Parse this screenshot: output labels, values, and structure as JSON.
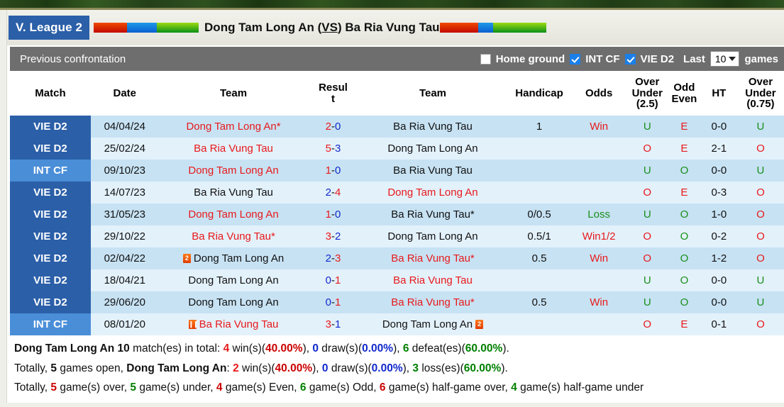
{
  "header": {
    "league_badge": "V. League 2",
    "match_title_home": "Dong Tam Long An",
    "match_title_vs": "VS",
    "match_title_away": "Ba Ria Vung Tau",
    "title_open_paren": " (",
    "title_close_paren": ") ",
    "accent_badge_color": "#2b5fa8"
  },
  "controls": {
    "section_title": "Previous confrontation",
    "home_ground_label": "Home ground",
    "home_ground_checked": false,
    "int_cf_label": "INT CF",
    "int_cf_checked": true,
    "vie_d2_label": "VIE D2",
    "vie_d2_checked": true,
    "last_label": "Last",
    "last_value": "10",
    "games_label": "games"
  },
  "table": {
    "columns": [
      "Match",
      "Date",
      "Team",
      "Result",
      "Team",
      "Handicap",
      "Odds",
      "Over Under (2.5)",
      "Odd Even",
      "HT",
      "Over Under (0.75)"
    ],
    "headers": {
      "match": "Match",
      "date": "Date",
      "team_home": "Team",
      "result_l1": "Resul",
      "result_l2": "t",
      "team_away": "Team",
      "handicap": "Handicap",
      "odds": "Odds",
      "ou25_l1": "Over",
      "ou25_l2": "Under",
      "ou25_l3": "(2.5)",
      "oe_l1": "Odd",
      "oe_l2": "Even",
      "ht": "HT",
      "ou075_l1": "Over",
      "ou075_l2": "Under",
      "ou075_l3": "(0.75)"
    },
    "rows": [
      {
        "match": "VIE D2",
        "match_type": "vie",
        "date": "04/04/24",
        "home": "Dong Tam Long An*",
        "home_color": "red",
        "home_icon": "",
        "score_home": "2",
        "score_home_color": "red",
        "score_away": "0",
        "score_away_color": "blue",
        "away": "Ba Ria Vung Tau",
        "away_color": "black",
        "away_icon": "",
        "handicap": "1",
        "odds": "Win",
        "odds_color": "red",
        "ou25": "U",
        "ou25_color": "green",
        "oe": "E",
        "oe_color": "red",
        "ht": "0-0",
        "ou075": "U",
        "ou075_color": "green"
      },
      {
        "match": "VIE D2",
        "match_type": "vie",
        "date": "25/02/24",
        "home": "Ba Ria Vung Tau",
        "home_color": "red",
        "home_icon": "",
        "score_home": "5",
        "score_home_color": "red",
        "score_away": "3",
        "score_away_color": "blue",
        "away": "Dong Tam Long An",
        "away_color": "black",
        "away_icon": "",
        "handicap": "",
        "odds": "",
        "odds_color": "black",
        "ou25": "O",
        "ou25_color": "red",
        "oe": "E",
        "oe_color": "red",
        "ht": "2-1",
        "ou075": "O",
        "ou075_color": "red"
      },
      {
        "match": "INT CF",
        "match_type": "int",
        "date": "09/10/23",
        "home": "Dong Tam Long An",
        "home_color": "red",
        "home_icon": "",
        "score_home": "1",
        "score_home_color": "red",
        "score_away": "0",
        "score_away_color": "blue",
        "away": "Ba Ria Vung Tau",
        "away_color": "black",
        "away_icon": "",
        "handicap": "",
        "odds": "",
        "odds_color": "black",
        "ou25": "U",
        "ou25_color": "green",
        "oe": "O",
        "oe_color": "green",
        "ht": "0-0",
        "ou075": "U",
        "ou075_color": "green"
      },
      {
        "match": "VIE D2",
        "match_type": "vie",
        "date": "14/07/23",
        "home": "Ba Ria Vung Tau",
        "home_color": "black",
        "home_icon": "",
        "score_home": "2",
        "score_home_color": "blue",
        "score_away": "4",
        "score_away_color": "red",
        "away": "Dong Tam Long An",
        "away_color": "red",
        "away_icon": "",
        "handicap": "",
        "odds": "",
        "odds_color": "black",
        "ou25": "O",
        "ou25_color": "red",
        "oe": "E",
        "oe_color": "red",
        "ht": "0-3",
        "ou075": "O",
        "ou075_color": "red"
      },
      {
        "match": "VIE D2",
        "match_type": "vie",
        "date": "31/05/23",
        "home": "Dong Tam Long An",
        "home_color": "red",
        "home_icon": "",
        "score_home": "1",
        "score_home_color": "red",
        "score_away": "0",
        "score_away_color": "blue",
        "away": "Ba Ria Vung Tau*",
        "away_color": "black",
        "away_icon": "",
        "handicap": "0/0.5",
        "odds": "Loss",
        "odds_color": "green",
        "ou25": "U",
        "ou25_color": "green",
        "oe": "O",
        "oe_color": "green",
        "ht": "1-0",
        "ou075": "O",
        "ou075_color": "red"
      },
      {
        "match": "VIE D2",
        "match_type": "vie",
        "date": "29/10/22",
        "home": "Ba Ria Vung Tau*",
        "home_color": "red",
        "home_icon": "",
        "score_home": "3",
        "score_home_color": "red",
        "score_away": "2",
        "score_away_color": "blue",
        "away": "Dong Tam Long An",
        "away_color": "black",
        "away_icon": "",
        "handicap": "0.5/1",
        "odds": "Win1/2",
        "odds_color": "red",
        "ou25": "O",
        "ou25_color": "red",
        "oe": "O",
        "oe_color": "green",
        "ht": "0-2",
        "ou075": "O",
        "ou075_color": "red"
      },
      {
        "match": "VIE D2",
        "match_type": "vie",
        "date": "02/04/22",
        "home": "Dong Tam Long An",
        "home_color": "black",
        "home_icon": "red-card-icon",
        "score_home": "2",
        "score_home_color": "blue",
        "score_away": "3",
        "score_away_color": "red",
        "away": "Ba Ria Vung Tau*",
        "away_color": "red",
        "away_icon": "",
        "handicap": "0.5",
        "odds": "Win",
        "odds_color": "red",
        "ou25": "O",
        "ou25_color": "red",
        "oe": "O",
        "oe_color": "green",
        "ht": "1-2",
        "ou075": "O",
        "ou075_color": "red"
      },
      {
        "match": "VIE D2",
        "match_type": "vie",
        "date": "18/04/21",
        "home": "Dong Tam Long An",
        "home_color": "black",
        "home_icon": "",
        "score_home": "0",
        "score_home_color": "blue",
        "score_away": "1",
        "score_away_color": "red",
        "away": "Ba Ria Vung Tau",
        "away_color": "red",
        "away_icon": "",
        "handicap": "",
        "odds": "",
        "odds_color": "black",
        "ou25": "U",
        "ou25_color": "green",
        "oe": "O",
        "oe_color": "green",
        "ht": "0-0",
        "ou075": "U",
        "ou075_color": "green"
      },
      {
        "match": "VIE D2",
        "match_type": "vie",
        "date": "29/06/20",
        "home": "Dong Tam Long An",
        "home_color": "black",
        "home_icon": "",
        "score_home": "0",
        "score_home_color": "blue",
        "score_away": "1",
        "score_away_color": "red",
        "away": "Ba Ria Vung Tau*",
        "away_color": "red",
        "away_icon": "",
        "handicap": "0.5",
        "odds": "Win",
        "odds_color": "red",
        "ou25": "U",
        "ou25_color": "green",
        "oe": "O",
        "oe_color": "green",
        "ht": "0-0",
        "ou075": "U",
        "ou075_color": "green"
      },
      {
        "match": "INT CF",
        "match_type": "int",
        "date": "08/01/20",
        "home": "Ba Ria Vung Tau",
        "home_color": "red",
        "home_icon": "double-yellow-card-icon",
        "score_home": "3",
        "score_home_color": "red",
        "score_away": "1",
        "score_away_color": "blue",
        "away": "Dong Tam Long An",
        "away_color": "black",
        "away_icon": "red-card-icon",
        "handicap": "",
        "odds": "",
        "odds_color": "black",
        "ou25": "O",
        "ou25_color": "red",
        "oe": "E",
        "oe_color": "red",
        "ht": "0-1",
        "ou075": "O",
        "ou075_color": "red"
      }
    ]
  },
  "summary": {
    "line1": {
      "team": "Dong Tam Long An",
      "total_count": "10",
      "total_text": " match(es) in total: ",
      "wins": "4",
      "wins_text": " win(s)(",
      "wins_pct": "40.00%",
      "sep1": "), ",
      "draws": "0",
      "draws_text": " draw(s)(",
      "draws_pct": "0.00%",
      "sep2": "), ",
      "defeats": "6",
      "defeats_text": " defeat(es)(",
      "defeats_pct": "60.00%",
      "end": ")."
    },
    "line2": {
      "prefix": "Totally, ",
      "open_count": "5",
      "open_text": " games open, ",
      "team": "Dong Tam Long An",
      "colon": ": ",
      "wins": "2",
      "wins_text": " win(s)(",
      "wins_pct": "40.00%",
      "sep1": "), ",
      "draws": "0",
      "draws_text": " draw(s)(",
      "draws_pct": "0.00%",
      "sep2": "), ",
      "losses": "3",
      "losses_text": " loss(es)(",
      "losses_pct": "60.00%",
      "end": ")."
    },
    "line3": {
      "prefix": "Totally, ",
      "over": "5",
      "over_text": " game(s) over, ",
      "under": "5",
      "under_text": " game(s) under, ",
      "even": "4",
      "even_text": " game(s) Even, ",
      "odd": "6",
      "odd_text": " game(s) Odd, ",
      "half_over": "6",
      "half_over_text": " game(s) half-game over, ",
      "half_under": "4",
      "half_under_text": " game(s) half-game under"
    }
  }
}
